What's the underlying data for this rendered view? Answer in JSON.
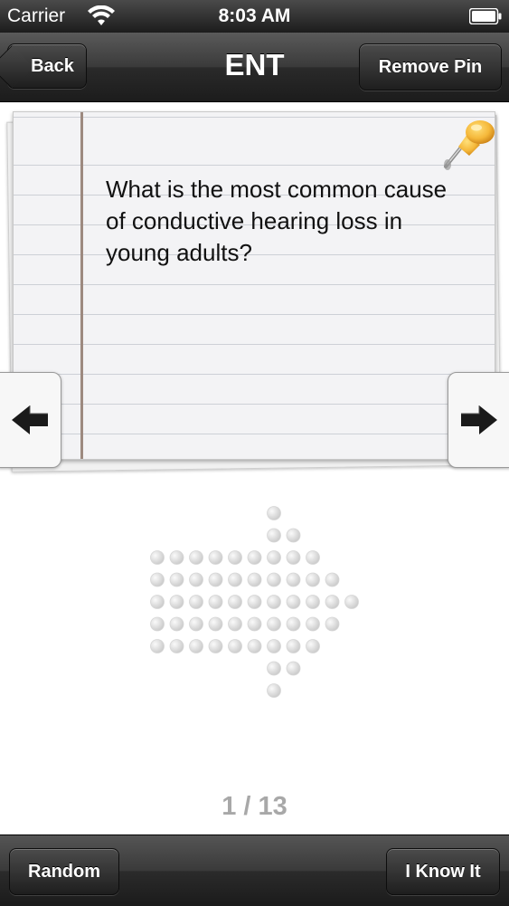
{
  "status_bar": {
    "carrier": "Carrier",
    "time": "8:03 AM"
  },
  "nav": {
    "back_label": "Back",
    "title": "ENT",
    "remove_pin_label": "Remove Pin"
  },
  "card": {
    "question": "What is the most common cause of conductive hearing loss in young adults?"
  },
  "pager": {
    "counter": "1 / 13"
  },
  "toolbar": {
    "random_label": "Random",
    "know_label": "I Know It"
  },
  "icons": {
    "wifi": "wifi-icon",
    "battery": "battery-icon",
    "pin": "pushpin-icon",
    "prev": "arrow-left-icon",
    "next": "arrow-right-icon",
    "swipe_hint": "dotted-arrow-right-icon"
  },
  "colors": {
    "bar_dark": "#1c1c1c",
    "pin_yellow": "#f5b83a",
    "card_bg": "#f3f3f5",
    "counter_gray": "#a8a8a8"
  }
}
